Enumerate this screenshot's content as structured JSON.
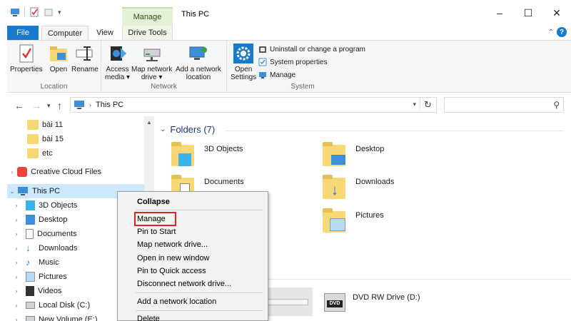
{
  "window": {
    "title": "This PC",
    "context_tab_header": "Manage",
    "controls": [
      "–",
      "☐",
      "✕"
    ]
  },
  "tabs": {
    "file": "File",
    "computer": "Computer",
    "view": "View",
    "drive_tools": "Drive Tools"
  },
  "ribbon": {
    "location": {
      "label": "Location",
      "properties": "Properties",
      "open": "Open",
      "rename": "Rename"
    },
    "network": {
      "label": "Network",
      "access_media_1": "Access",
      "access_media_2": "media ▾",
      "map_drive_1": "Map network",
      "map_drive_2": "drive ▾",
      "add_location_1": "Add a network",
      "add_location_2": "location"
    },
    "system": {
      "label": "System",
      "open_settings_1": "Open",
      "open_settings_2": "Settings",
      "uninstall": "Uninstall or change a program",
      "system_properties": "System properties",
      "manage": "Manage"
    }
  },
  "address": {
    "path": "This PC"
  },
  "navpane": {
    "items": [
      {
        "label": "bài 11"
      },
      {
        "label": "bài 15"
      },
      {
        "label": "etc"
      },
      {
        "label": "Creative Cloud Files"
      },
      {
        "label": "This PC"
      },
      {
        "label": "3D Objects"
      },
      {
        "label": "Desktop"
      },
      {
        "label": "Documents"
      },
      {
        "label": "Downloads"
      },
      {
        "label": "Music"
      },
      {
        "label": "Pictures"
      },
      {
        "label": "Videos"
      },
      {
        "label": "Local Disk (C:)"
      },
      {
        "label": "New Volume (E:)"
      }
    ]
  },
  "content": {
    "folders_header": "Folders (7)",
    "folders": [
      {
        "name": "3D Objects"
      },
      {
        "name": "Desktop"
      },
      {
        "name": "Documents"
      },
      {
        "name": "Downloads"
      },
      {
        "name": "Pictures"
      }
    ],
    "dvd": "DVD RW Drive (D:)",
    "dvd_label": "DVD"
  },
  "context_menu": {
    "items": [
      "Collapse",
      "Manage",
      "Pin to Start",
      "Map network drive...",
      "Open in new window",
      "Pin to Quick access",
      "Disconnect network drive...",
      "Add a network location",
      "Delete"
    ]
  },
  "colors": {
    "accent": "#1979ca",
    "selection": "#cce8ff",
    "highlight": "#e0202a"
  }
}
